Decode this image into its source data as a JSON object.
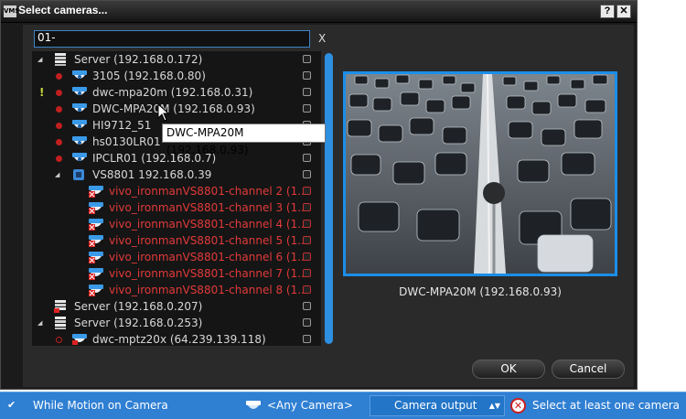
{
  "window": {
    "title": "Select cameras...",
    "logo": "VMS",
    "help_label": "?",
    "close_label": "✕"
  },
  "search": {
    "value": "01-",
    "clear_label": "X"
  },
  "tree": {
    "items": [
      {
        "label": "Server (192.168.0.172)",
        "kind": "server",
        "expanded": true,
        "red": false
      },
      {
        "label": "3105 (192.168.0.80)",
        "kind": "camera",
        "red": false
      },
      {
        "label": "dwc-mpa20m (192.168.0.31)",
        "kind": "camera",
        "alert": "!",
        "red": false
      },
      {
        "label": "DWC-MPA20M (192.168.0.93)",
        "kind": "camera",
        "red": false
      },
      {
        "label": "HI9712_51",
        "kind": "camera",
        "red": false
      },
      {
        "label": "hs0130LR01",
        "kind": "camera",
        "red": false
      },
      {
        "label": "IPCLR01 (192.168.0.7)",
        "kind": "camera",
        "red": false
      },
      {
        "label": "VS8801 192.168.0.39",
        "kind": "encoder",
        "expanded": true,
        "red": false
      },
      {
        "label": "vivo_ironmanVS8801-channel 2 (1...",
        "kind": "channel",
        "red": true
      },
      {
        "label": "vivo_ironmanVS8801-channel 3 (1...",
        "kind": "channel",
        "red": true
      },
      {
        "label": "vivo_ironmanVS8801-channel 4 (1...",
        "kind": "channel",
        "red": true
      },
      {
        "label": "vivo_ironmanVS8801-channel 5 (1...",
        "kind": "channel",
        "red": true
      },
      {
        "label": "vivo_ironmanVS8801-channel 6 (1...",
        "kind": "channel",
        "red": true
      },
      {
        "label": "vivo_ironmanVS8801-channel 7 (1...",
        "kind": "channel",
        "red": true
      },
      {
        "label": "vivo_ironmanVS8801-channel 8 (1...",
        "kind": "channel",
        "red": true
      },
      {
        "label": "Server (192.168.0.207)",
        "kind": "server-offline",
        "red": false
      },
      {
        "label": "Server (192.168.0.253)",
        "kind": "server",
        "expanded": true,
        "red": false
      },
      {
        "label": "dwc-mptz20x (64.239.139.118)",
        "kind": "camera-ptz",
        "red": false
      }
    ]
  },
  "tooltip": {
    "text": "DWC-MPA20M (192.168.0.93)"
  },
  "preview": {
    "caption": "DWC-MPA20M (192.168.0.93)"
  },
  "buttons": {
    "ok": "OK",
    "cancel": "Cancel"
  },
  "statusbar": {
    "condition_label": "While Motion on Camera",
    "camera_select": "<Any Camera>",
    "output_select": "Camera output",
    "error_text": "Select at least one camera"
  },
  "colors": {
    "accent": "#1b8ee8",
    "error": "#e23a3a",
    "statusbar": "#2f7fd3"
  }
}
